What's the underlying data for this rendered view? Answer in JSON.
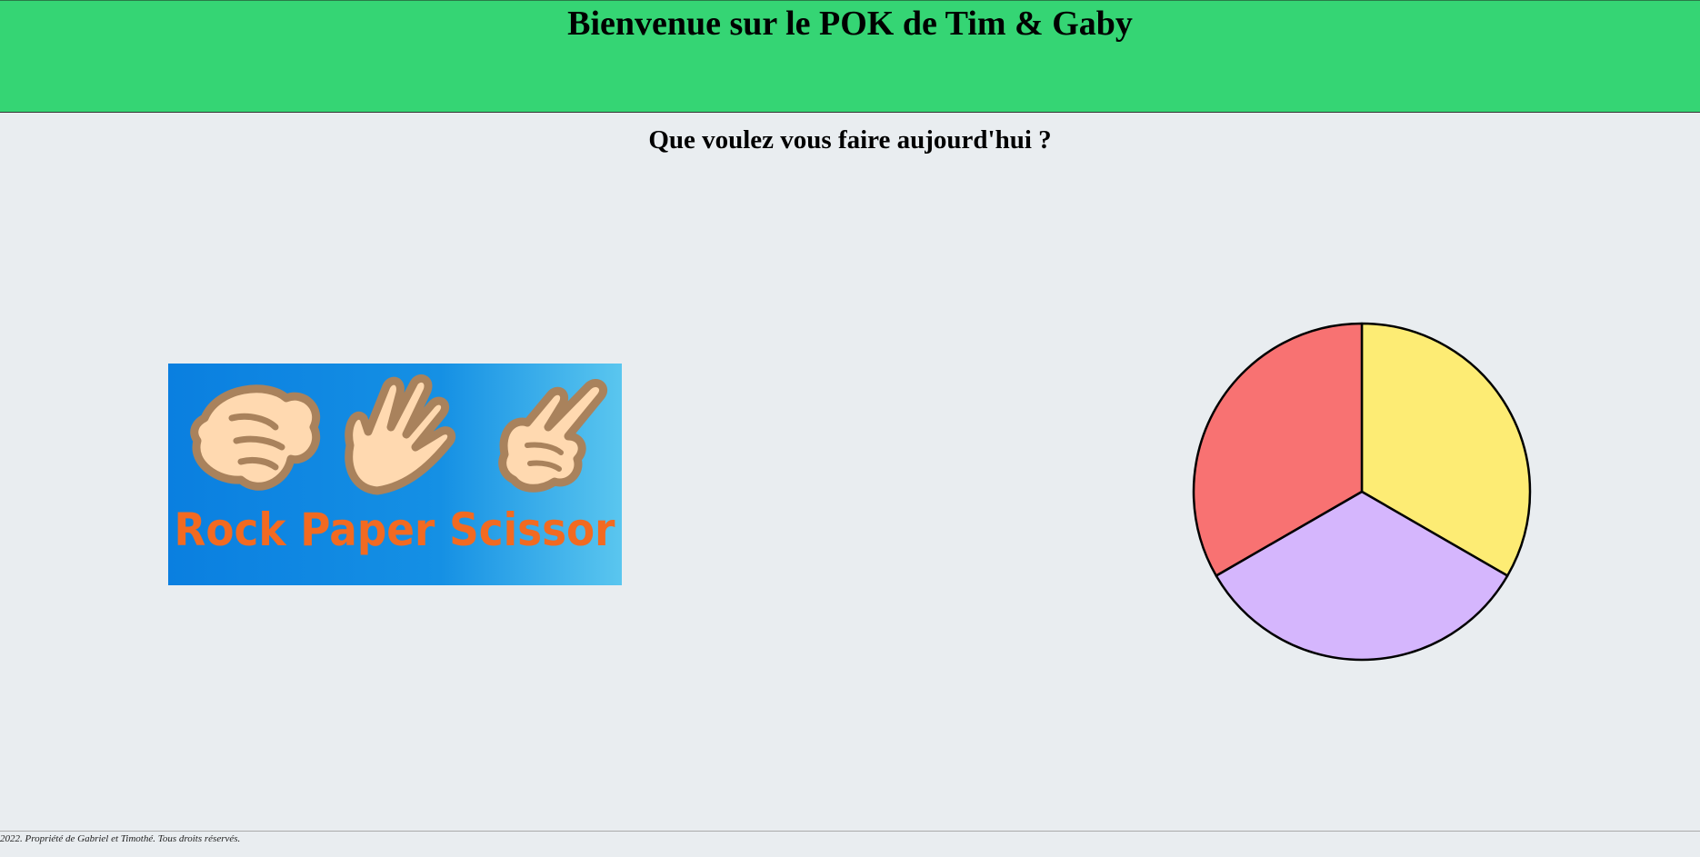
{
  "header": {
    "title": "Bienvenue sur le POK de Tim & Gaby",
    "background_color": "#35d574"
  },
  "main": {
    "subtitle": "Que voulez vous faire aujourd'hui ?",
    "games": [
      {
        "name": "Rock Paper Scissor",
        "image_text": "Rock Paper Scissor",
        "icons": [
          "rock-hand-icon",
          "paper-hand-icon",
          "scissor-hand-icon"
        ]
      },
      {
        "name": "wheel",
        "segment_colors": [
          "#fdec74",
          "#d5b6fd",
          "#f87272"
        ]
      }
    ]
  },
  "footer": {
    "text": "2022. Propriété de Gabriel et Timothé. Tous droits réservés."
  }
}
